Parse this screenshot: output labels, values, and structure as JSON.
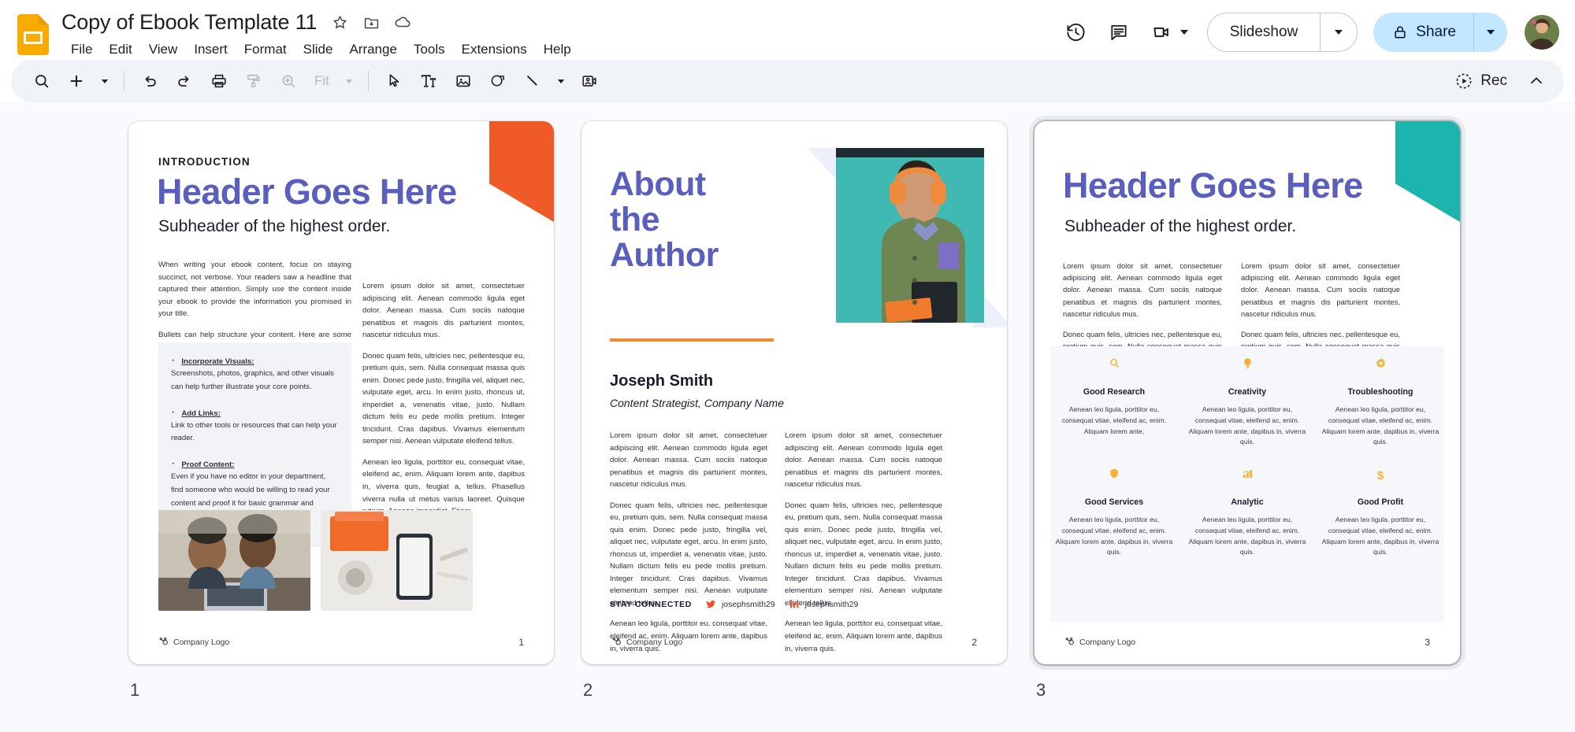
{
  "app": {
    "logo_icon": "google-slides-icon",
    "doc_title": "Copy of Ebook Template 11",
    "star_icon": "star-icon",
    "move_icon": "move-to-folder-icon",
    "cloud_icon": "cloud-saved-icon",
    "menus": [
      "File",
      "Edit",
      "View",
      "Insert",
      "Format",
      "Slide",
      "Arrange",
      "Tools",
      "Extensions",
      "Help"
    ],
    "actions": {
      "history_icon": "version-history-icon",
      "comment_icon": "comment-icon",
      "meet_icon": "google-meet-icon",
      "slideshow_label": "Slideshow",
      "share_label": "Share",
      "lock_icon": "lock-icon",
      "avatar_icon": "user-avatar"
    }
  },
  "toolbar": {
    "search_icon": "search-icon",
    "new_slide_icon": "new-slide-plus-icon",
    "undo_icon": "undo-icon",
    "redo_icon": "redo-icon",
    "print_icon": "print-icon",
    "paint_icon": "paint-format-icon",
    "zoom_icon": "zoom-icon",
    "zoom_value": "Fit",
    "select_icon": "select-cursor-icon",
    "textbox_icon": "text-box-icon",
    "image_icon": "insert-image-icon",
    "shape_icon": "insert-shape-icon",
    "line_icon": "insert-line-icon",
    "video_icon": "insert-video-icon",
    "rec_icon": "record-icon",
    "rec_label": "Rec",
    "collapse_icon": "chevron-up-icon"
  },
  "slides": [
    {
      "number": "1",
      "label": "1",
      "selected": false,
      "accent_color": "#f05a28",
      "eyebrow": "INTRODUCTION",
      "heading": "Header Goes  Here",
      "subheading": "Subheader of the highest order.",
      "intro_p1": "When writing your ebook content, focus on staying succinct, not verbose. Your readers saw a headline that captured their attention. Simply use the content inside your ebook to provide the information you promised in your title.",
      "intro_p2": "Bullets can help structure your content. Here are some additional tips for creating ebooks:",
      "tips": [
        {
          "title": "Incorporate Visuals:",
          "desc": "Screenshots, photos, graphics, and other visuals can help further illustrate your core points."
        },
        {
          "title": "Add Links:",
          "desc": "Link to other tools or resources that can help your reader."
        },
        {
          "title": "Proof Content:",
          "desc": "Even if you have no editor in your department, find someone who would be willing to read your content and proof it for basic grammar and spelling."
        }
      ],
      "right_p1": "Lorem ipsum dolor sit amet, consectetuer adipiscing elit. Aenean commodo ligula eget dolor. Aenean massa. Cum sociis natoque penatibus et magnis dis parturient montes, nascetur ridiculus mus.",
      "right_p2": "Donec quam felis, ultricies nec, pellentesque eu, pretium quis, sem. Nulla consequat massa quis enim. Donec pede justo, fringilla vel, aliquet nec, vulputate eget, arcu. In enim justo, rhoncus ut, imperdiet a, venenatis vitae, justo. Nullam dictum felis eu pede mollis pretium. Integer tincidunt. Cras dapibus. Vivamus elementum semper nisi. Aenean vulputate eleifend tellus.",
      "right_p3": "Aenean leo ligula, porttitor eu, consequat vitae, eleifend ac, enim. Aliquam lorem ante, dapibus in, viverra quis, feugiat a, tellus. Phasellus viverra nulla ut metus varius laoreet. Quisque rutrum. Aenean imperdiet. Etiam",
      "footer_logo": "Company Logo"
    },
    {
      "number": "2",
      "label": "2",
      "selected": false,
      "heading": "About\nthe\nAuthor",
      "author_name": "Joseph Smith",
      "author_role": "Content Strategist, Company Name",
      "left_p1": "Lorem ipsum dolor sit amet, consectetuer adipiscing elit. Aenean commodo ligula eget dolor. Aenean massa. Cum sociis natoque penatibus et magnis dis parturient montes, nascetur ridiculus mus.",
      "left_p2": "Donec quam felis, ultricies nec, pellentesque eu, pretium quis, sem. Nulla consequat massa quis enim. Donec pede justo, fringilla vel, aliquet nec, vulputate eget, arcu. In enim justo, rhoncus ut, imperdiet a, venenatis vitae, justo. Nullam dictum felis eu pede mollis pretium. Integer tincidunt. Cras dapibus. Vivamus elementum semper nisi. Aenean vulputate eleifend tellus.",
      "left_p3": "Aenean leo ligula, porttitor eu, consequat vitae, eleifend ac, enim. Aliquam lorem ante, dapibus in, viverra quis.",
      "right_p1": "Lorem ipsum dolor sit amet, consectetuer adipiscing elit. Aenean commodo ligula eget dolor. Aenean massa. Cum sociis natoque penatibus et magnis dis parturient montes, nascetur ridiculus mus.",
      "right_p2": "Donec quam felis, ultricies nec, pellentesque eu, pretium quis, sem. Nulla consequat massa quis enim. Donec pede justo, fringilla vel, aliquet nec, vulputate eget, arcu. In enim justo, rhoncus ut, imperdiet a, venenatis vitae, justo. Nullam dictum felis eu pede mollis pretium. Integer tincidunt. Cras dapibus. Vivamus elementum semper nisi. Aenean vulputate eleifend tellus.",
      "right_p3": "Aenean leo ligula, porttitor eu, consequat vitae, eleifend ac, enim. Aliquam lorem ante, dapibus in, viverra quis.",
      "stay_connected": "STAY CONNECTED",
      "twitter_handle": "josephsmith29",
      "linkedin_handle": "josephsmith29",
      "footer_logo": "Company Logo"
    },
    {
      "number": "3",
      "label": "3",
      "selected": true,
      "accent_color": "#1cb5ad",
      "heading": "Header Goes  Here",
      "subheading": "Subheader of the highest order.",
      "col1_p1": "Lorem ipsum dolor sit amet, consectetuer adipiscing elit. Aenean commodo ligula eget dolor. Aenean massa. Cum sociis natoque penatibus et magnis dis parturient montes, nascetur ridiculus mus.",
      "col1_p2": "Donec quam felis, ultricies nec, pellentesque eu, pretium quis, sem. Nulla consequat massa quis enim. Donec pede justo, fringilla vel, aliquet nec, vulputate eget, arcu. In enim justo, rhoncus ut, imperdiet a, venenatis vitae, justo. Nullam dictum felis eu pede mollis pretium. Integer",
      "col2_p1": "Lorem ipsum dolor sit amet, consectetuer adipiscing elit. Aenean commodo ligula eget dolor. Aenean massa. Cum sociis natoque penatibus et magnis dis parturient montes, nascetur ridiculus mus.",
      "col2_p2": "Donec quam felis, ultricies nec, pellentesque eu, pretium quis, sem. Nulla consequat massa quis enim. Donec pede justo, fringilla vel, aliquet nec, vulputate eget, arcu. In enim justo, rhoncus ut, imperdiet a, venenatis vitae, justo. Nullam dictum felis eu pede mollis pretium. Integer",
      "features": [
        {
          "icon": "magnifier-icon",
          "glyph": "⌕",
          "title": "Good Research",
          "desc": "Aenean leo ligula, porttitor eu, consequat vitae, eleifend ac, enim. Aliquam lorem ante,"
        },
        {
          "icon": "lightbulb-icon",
          "glyph": "Ὂ1",
          "title": "Creativity",
          "desc": "Aenean leo ligula, porttitor eu, consequat vitae, eleifend ac, enim. Aliquam lorem ante, dapibus in, viverra quis."
        },
        {
          "icon": "gear-icon",
          "glyph": "⚙",
          "title": "Troubleshooting",
          "desc": "Aenean leo ligula, porttitor eu, consequat vitae, eleifend ac, enim. Aliquam lorem ante, dapibus in, viverra quis."
        },
        {
          "icon": "shield-icon",
          "glyph": "⛨",
          "title": "Good Services",
          "desc": "Aenean leo ligula, porttitor eu, consequat vitae, eleifend ac, enim. Aliquam lorem ante, dapibus in, viverra quis."
        },
        {
          "icon": "bar-chart-icon",
          "glyph": "ὌA",
          "title": "Analytic",
          "desc": "Aenean leo ligula, porttitor eu, consequat vitae, eleifend ac, enim. Aliquam lorem ante, dapibus in, viverra quis."
        },
        {
          "icon": "dollar-icon",
          "glyph": "$",
          "title": "Good Profit",
          "desc": "Aenean leo ligula, porttitor eu, consequat vitae, eleifend ac, enim. Aliquam lorem ante, dapibus in, viverra quis."
        }
      ],
      "footer_logo": "Company Logo"
    }
  ],
  "colors": {
    "heading_purple": "#5a5fbe",
    "orange_accent": "#f05a28",
    "teal_accent": "#1cb5ad",
    "share_blue": "#c2e7ff",
    "toolbar_bg": "#f0f4f9",
    "icon_gold": "#f5b335"
  }
}
